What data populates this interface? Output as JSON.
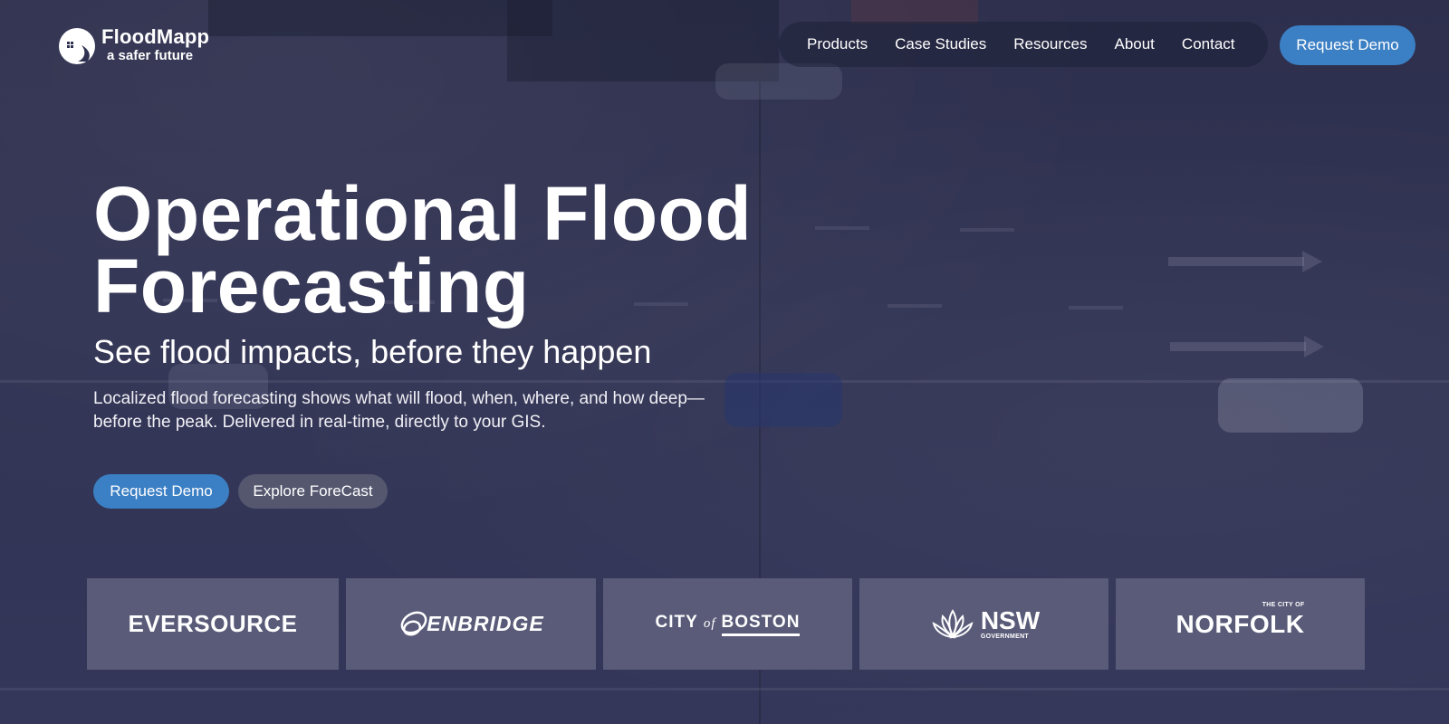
{
  "brand": {
    "name": "FloodMapp",
    "tagline": "a safer future"
  },
  "nav": {
    "items": [
      {
        "label": "Products"
      },
      {
        "label": "Case Studies"
      },
      {
        "label": "Resources"
      },
      {
        "label": "About"
      },
      {
        "label": "Contact"
      }
    ],
    "cta_label": "Request Demo"
  },
  "hero": {
    "title_line1": "Operational Flood",
    "title_line2": "Forecasting",
    "subtitle": "See flood impacts, before they happen",
    "description": "Localized flood forecasting shows what will flood, when, where, and how deep—before the peak. Delivered in real-time, directly to your GIS.",
    "primary_cta": "Request Demo",
    "secondary_cta": "Explore ForeCast"
  },
  "client_logos": {
    "eversource": "EVERSOURCE",
    "enbridge": "ENBRIDGE",
    "boston_city": "CITY",
    "boston_of": "of",
    "boston_name": "BOSTON",
    "nsw": "NSW",
    "nsw_sub": "GOVERNMENT",
    "norfolk_small": "THE CITY OF",
    "norfolk": "NORFOLK"
  },
  "colors": {
    "accent": "#3b7fc4",
    "background": "#2f3150",
    "logo_card": "#595b78",
    "secondary_button": "#55576f"
  }
}
